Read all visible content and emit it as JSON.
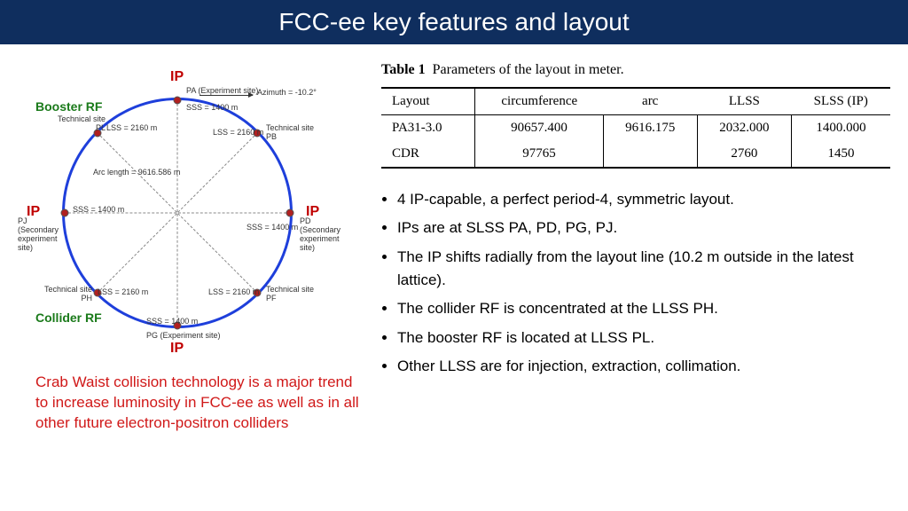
{
  "title": "FCC-ee key features and layout",
  "diagram": {
    "ip_top": "IP",
    "ip_right": "IP",
    "ip_bottom": "IP",
    "ip_left": "IP",
    "booster_rf": "Booster RF",
    "collider_rf": "Collider RF",
    "azimuth": "Azimuth = -10.2°",
    "pa": "PA (Experiment site)",
    "pb": "Technical site\nPB",
    "pd": "PD\n(Secondary\nexperiment\nsite)",
    "pf": "Technical site\nPF",
    "pg": "PG (Experiment site)",
    "ph": "Technical site\nPH",
    "pj": "PJ\n(Secondary\nexperiment\nsite)",
    "pl": "Technical site\nPL",
    "lss_pb": "LSS = 2160 m",
    "lss_pf": "LSS = 2160 m",
    "lss_ph": "LSS = 2160 m",
    "lss_pl": "LSS = 2160 m",
    "sss_pa": "SSS = 1400 m",
    "sss_pd": "SSS = 1400 m",
    "sss_pg": "SSS = 1400 m",
    "sss_pj": "SSS = 1400 m",
    "arc_length": "Arc length = 9616.586 m"
  },
  "crab_waist": "Crab Waist collision technology is a major trend to increase luminosity in FCC-ee as well as in all other future electron-positron colliders",
  "table": {
    "caption_label": "Table 1",
    "caption_text": "Parameters of the layout in meter.",
    "headers": [
      "Layout",
      "circumference",
      "arc",
      "LLSS",
      "SLSS (IP)"
    ],
    "rows": [
      [
        "PA31-3.0",
        "90657.400",
        "9616.175",
        "2032.000",
        "1400.000"
      ],
      [
        "CDR",
        "97765",
        "",
        "2760",
        "1450"
      ]
    ]
  },
  "bullets": [
    "4 IP-capable, a perfect period-4, symmetric layout.",
    "IPs are at SLSS PA, PD, PG, PJ.",
    "The IP shifts radially from the layout line (10.2 m outside in the latest lattice).",
    "The collider RF is concentrated at the LLSS PH.",
    " The booster RF is located at LLSS PL.",
    "Other LLSS are for injection, extraction, collimation."
  ]
}
